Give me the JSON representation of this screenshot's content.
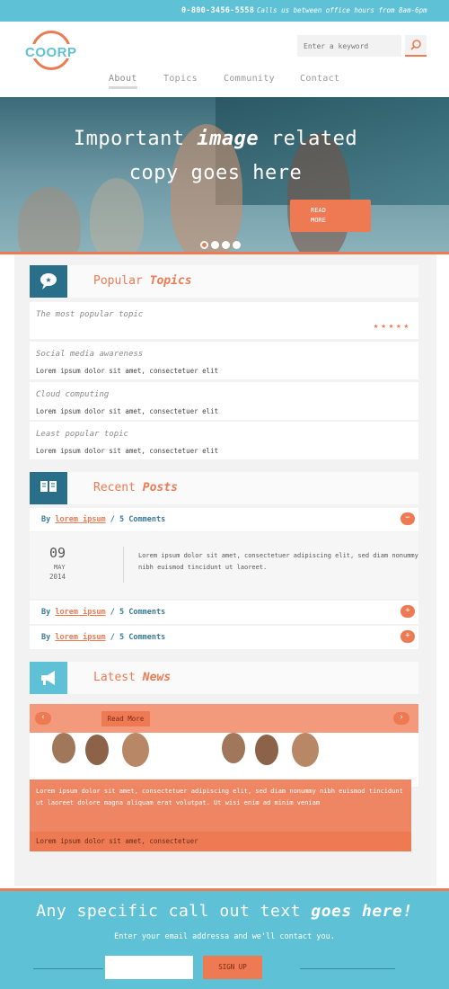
{
  "topbar": {
    "phone": "0-800-3456-5558",
    "hours": "Calls us between office hours from 8am-6pm"
  },
  "logo": {
    "text": "COORP"
  },
  "search": {
    "placeholder": "Enter a keyword"
  },
  "nav": [
    {
      "label": "About",
      "active": true
    },
    {
      "label": "Topics",
      "active": false
    },
    {
      "label": "Community",
      "active": false
    },
    {
      "label": "Contact",
      "active": false
    }
  ],
  "hero": {
    "title_part1": "Important",
    "title_emphasis": "image",
    "title_part2": "related",
    "title_line2": "copy goes here",
    "read_more_line1": "READ",
    "read_more_line2": "MORE",
    "slides_count": 4,
    "active_slide": 1
  },
  "popular": {
    "title": "Popular",
    "title_emphasis": "Topics",
    "items": [
      {
        "title": "The most popular topic",
        "desc": "",
        "stars": "★★★★★"
      },
      {
        "title": "Social media awareness",
        "desc": "Lorem ipsum dolor sit amet, consectetuer elit"
      },
      {
        "title": "Cloud computing",
        "desc": "Lorem ipsum dolor sit amet, consectetuer elit"
      },
      {
        "title": "Least popular topic",
        "desc": "Lorem ipsum dolor sit amet, consectetuer elit"
      }
    ]
  },
  "recent": {
    "title": "Recent",
    "title_emphasis": "Posts",
    "posts": [
      {
        "by": "By",
        "author": "lorem ipsum",
        "comments": "/ 5 Comments",
        "btn": "−"
      },
      {
        "by": "By",
        "author": "lorem ipsum",
        "comments": "/ 5 Comments",
        "btn": "+"
      },
      {
        "by": "By",
        "author": "lorem ipsum",
        "comments": "/ 5 Comments",
        "btn": "+"
      }
    ],
    "expanded": {
      "day": "09",
      "month": "MAY",
      "year": "2014",
      "text": "Lorem ipsum dolor sit amet, consectetuer adipiscing elit, sed diam nonummy nibh euismod tincidunt ut laoreet."
    }
  },
  "news": {
    "title": "Latest",
    "title_emphasis": "News",
    "read_more": "Read More",
    "prev": "‹",
    "next": "›",
    "caption": "Lorem ipsum dolor sit amet, consectetuer adipiscing elit, sed diam nonummy nibh euismod tincidunt ut laoreet dolore magna aliquam erat volutpat. Ut wisi enim ad minim veniam",
    "footer": "Lorem ipsum dolor sit amet, consectetuer"
  },
  "cta": {
    "title_part1": "Any specific call out text",
    "title_emphasis": "goes here!",
    "subtitle": "Enter your email addressa and we'll contact you.",
    "button": "SIGN UP"
  },
  "colors": {
    "accent": "#ee7a53",
    "primary": "#5fc1d6",
    "dark_teal": "#2a6f8a"
  }
}
